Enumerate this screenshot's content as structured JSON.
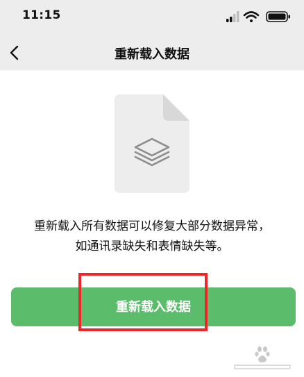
{
  "status_bar": {
    "time": "11:15"
  },
  "nav": {
    "title": "重新载入数据"
  },
  "main": {
    "description_line1": "重新载入所有数据可以修复大部分数据异常，",
    "description_line2": "如通讯录缺失和表情缺失等。",
    "button_label": "重新载入数据"
  },
  "icons": {
    "back": "chevron-left-icon",
    "signal": "cellular-signal-icon",
    "wifi": "wifi-icon",
    "battery": "battery-icon",
    "file": "file-layers-icon"
  },
  "colors": {
    "nav_bg": "#ededed",
    "button_bg": "#5bbd6b",
    "highlight": "#f02626"
  }
}
